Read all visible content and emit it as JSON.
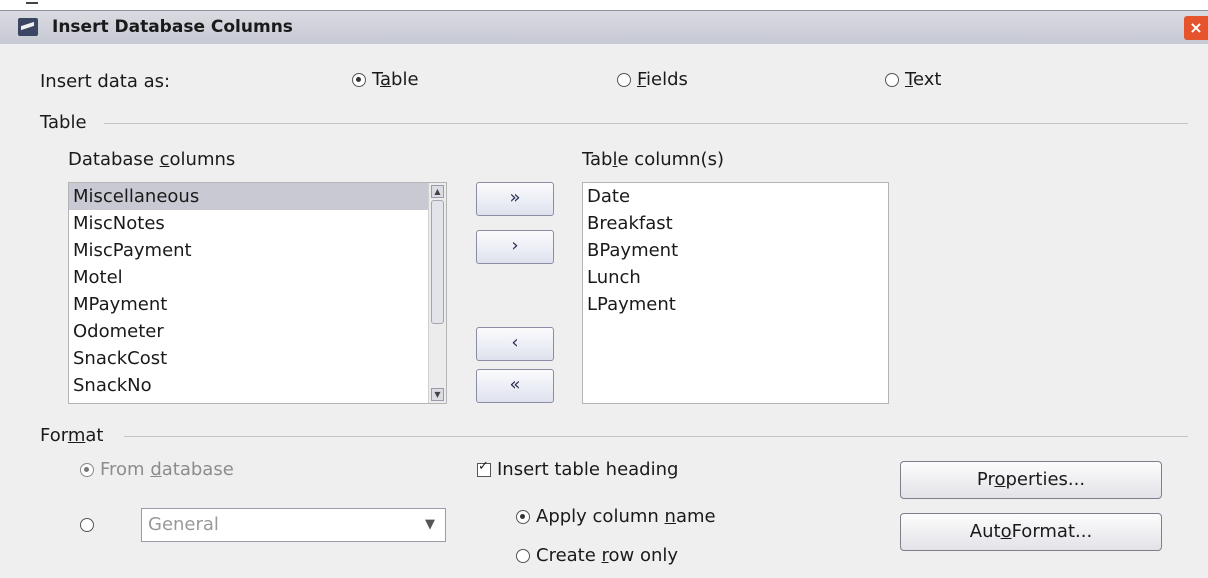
{
  "window": {
    "title": "Insert Database Columns",
    "close_glyph": "×"
  },
  "insert_as": {
    "label": "Insert data as:",
    "options": [
      {
        "pre": "T",
        "ul": "a",
        "post": "ble",
        "selected": true
      },
      {
        "pre": "",
        "ul": "F",
        "post": "ields",
        "selected": false
      },
      {
        "pre": "",
        "ul": "T",
        "post": "ext",
        "selected": false
      }
    ]
  },
  "table_section": {
    "title": "Table",
    "db_columns": {
      "label_pre": "Database ",
      "label_ul": "c",
      "label_post": "olumns",
      "items": [
        "Miscellaneous",
        "MiscNotes",
        "MiscPayment",
        "Motel",
        "MPayment",
        "Odometer",
        "SnackCost",
        "SnackNo"
      ],
      "selected_index": 0
    },
    "table_columns": {
      "label_pre": "Tab",
      "label_ul": "l",
      "label_post": "e column(s)",
      "items": [
        "Date",
        "Breakfast",
        "BPayment",
        "Lunch",
        "LPayment"
      ]
    },
    "buttons": {
      "add_all": "»",
      "add": "›",
      "remove": "‹",
      "remove_all": "«"
    }
  },
  "format_section": {
    "title_pre": "For",
    "title_ul": "m",
    "title_post": "at",
    "from_database": {
      "pre": "From ",
      "ul": "d",
      "post": "atabase",
      "selected": true,
      "disabled": true
    },
    "custom_format": {
      "selected": false,
      "combo_value": "General"
    },
    "insert_heading": {
      "label": "Insert table heading",
      "checked": true
    },
    "apply_column_name": {
      "pre": "Apply column ",
      "ul": "n",
      "post": "ame",
      "selected": true
    },
    "create_row_only": {
      "pre": "Create ",
      "ul": "r",
      "post": "ow only",
      "selected": false
    },
    "properties_button": {
      "pre": "Pr",
      "ul": "o",
      "post": "perties..."
    },
    "autoformat_button": {
      "pre": "Aut",
      "ul": "o",
      "post": "Format..."
    }
  },
  "colors": {
    "titlebar": "#c6c8d3",
    "close": "#e6542d",
    "selection": "#c9c9d3",
    "dialog_bg": "#efefef"
  }
}
